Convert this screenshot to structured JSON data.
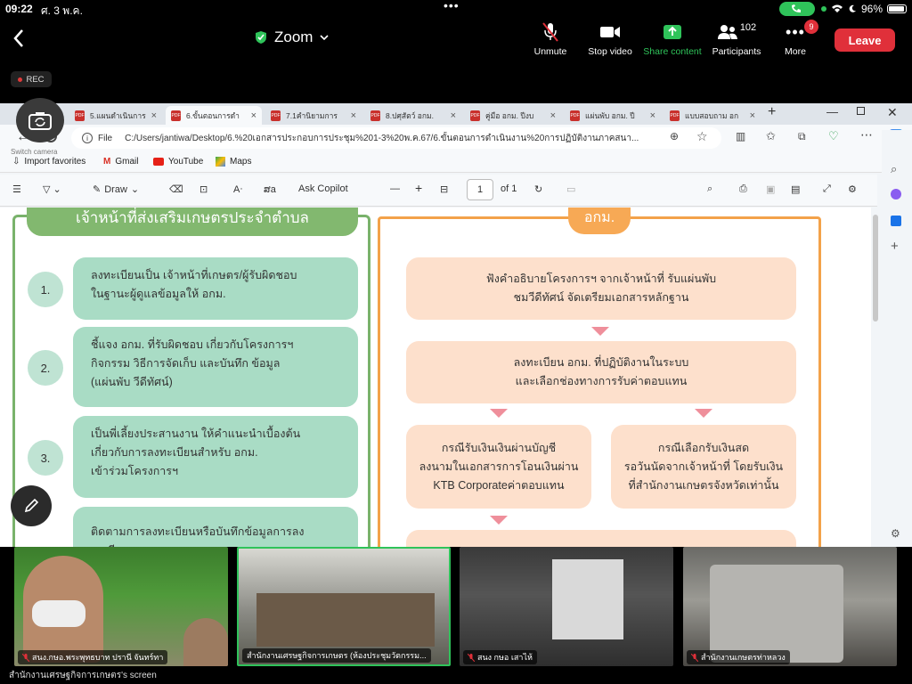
{
  "status_bar": {
    "time": "09:22",
    "date": "ศ. 3 พ.ค.",
    "battery": "96%"
  },
  "zoom_bar": {
    "title": "Zoom",
    "buttons": [
      {
        "label": "Unmute",
        "icon": "mic-muted-icon"
      },
      {
        "label": "Stop video",
        "icon": "video-camera-icon"
      },
      {
        "label": "Share content",
        "icon": "share-arrow-icon"
      },
      {
        "label": "Participants",
        "icon": "participants-icon",
        "count": "102"
      },
      {
        "label": "More",
        "icon": "more-icon",
        "badge": "9"
      }
    ],
    "leave": "Leave",
    "rec": "REC"
  },
  "camera_switch_label": "Switch camera",
  "browser": {
    "tabs": [
      {
        "label": "5.แผนดำเนินการ"
      },
      {
        "label": "6.ขั้นตอนการดำ"
      },
      {
        "label": "7.1คำนิยามการ"
      },
      {
        "label": "8.ปศุสัตว์ อกม."
      },
      {
        "label": "คู่มือ อกม. ปีงบ"
      },
      {
        "label": "แผ่นพับ อกม. ปี"
      },
      {
        "label": "แบบสอบถาม อก"
      }
    ],
    "address": {
      "prefix": "File",
      "url": "C:/Users/jantiwa/Desktop/6.%20เอกสารประกอบการประชุม%201-3%20พ.ค.67/6.ขั้นตอนการดำเนินงาน%20การปฏิบัติงานภาคสนา..."
    },
    "favorites": [
      {
        "label": "Import favorites"
      },
      {
        "label": "Gmail"
      },
      {
        "label": "YouTube"
      },
      {
        "label": "Maps"
      }
    ],
    "pdf_toolbar": {
      "draw": "Draw",
      "ask": "Ask Copilot",
      "page": "1",
      "of": "of 1"
    }
  },
  "document": {
    "left_heading": "เจ้าหน้าที่ส่งเสริมเกษตรประจำตำบล",
    "right_heading": "อกม.",
    "steps": [
      {
        "num": "1.",
        "lines": [
          "ลงทะเบียนเป็น เจ้าหน้าที่เกษตร/ผู้รับผิดชอบ",
          "ในฐานะผู้ดูแลข้อมูลให้ อกม."
        ]
      },
      {
        "num": "2.",
        "lines": [
          "ชี้แจง อกม. ที่รับผิดชอบ เกี่ยวกับโครงการฯ",
          "กิจกรรม วิธีการจัดเก็บ และบันทึก ข้อมูล",
          "(แผ่นพับ วีดีทัศน์)"
        ]
      },
      {
        "num": "3.",
        "lines": [
          "เป็นพี่เลี้ยงประสานงาน ให้คำแนะนำเบื้องต้น",
          "เกี่ยวกับการลงทะเบียนสำหรับ อกม.",
          "เข้าร่วมโครงการฯ"
        ]
      },
      {
        "num": "",
        "lines": [
          "ติดตามการลงทะเบียนหรือบันทึกข้อมูลการลงทะเบียน"
        ]
      }
    ],
    "flow": [
      {
        "lines": [
          "ฟังคำอธิบายโครงการฯ จากเจ้าหน้าที่ รับแผ่นพับ",
          "ชมวีดีทัศน์ จัดเตรียมเอกสารหลักฐาน"
        ]
      },
      {
        "lines": [
          "ลงทะเบียน อกม. ที่ปฏิบัติงานในระบบ",
          "และเลือกช่องทางการรับค่าตอบแทน"
        ]
      },
      {
        "lines": [
          "กรณีรับเงินเงินผ่านบัญชี",
          "ลงนามในเอกสารการโอนเงินผ่าน",
          "KTB Corporateค่าตอบแทน"
        ]
      },
      {
        "lines": [
          "กรณีเลือกรับเงินสด",
          "รอวันนัดจากเจ้าหน้าที่ โดยรับเงิน",
          "ที่สำนักงานเกษตรจังหวัดเท่านั้น"
        ]
      }
    ]
  },
  "participants": [
    {
      "name": "สนง.กษอ.พระพุทธบาท ปรานี จันทร์ทา"
    },
    {
      "name": "สำนักงานเศรษฐกิจการเกษตร (ห้องประชุมวัตกรรม..."
    },
    {
      "name": "สนง กษอ เสาไห้"
    },
    {
      "name": "สำนักงานเกษตรท่าหลวง"
    }
  ],
  "screen_owner": "สำนักงานเศรษฐกิจการเกษตร's screen",
  "colors": {
    "leave": "#e0303a",
    "share": "#2fc35a",
    "green_frame": "#79b26b",
    "orange_frame": "#f3a24a"
  }
}
